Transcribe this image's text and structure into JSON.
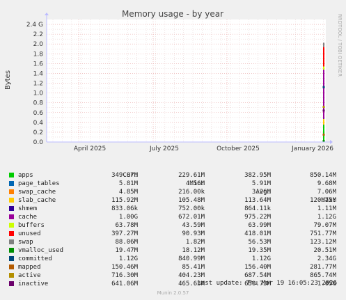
{
  "chart_data": {
    "type": "line",
    "title": "Memory usage - by year",
    "ylabel": "Bytes",
    "side_label": "RRDTOOL / TOBI OETIKER",
    "ylim": [
      0,
      2.5
    ],
    "y_unit": "G",
    "y_ticks": [
      "0.0",
      "0.2",
      "0.4",
      "0.6",
      "0.8",
      "1.0",
      "1.2",
      "1.4",
      "1.6",
      "1.8",
      "2.0",
      "2.2",
      "2.4 G"
    ],
    "x_ticks": [
      "April 2025",
      "July 2025",
      "October 2025",
      "January 2026"
    ],
    "grid": true,
    "last_values_G": {
      "apps": 0.34978,
      "page_tables": 0.00581,
      "swap_cache": 0.00485,
      "slab_cache": 0.11592,
      "shmem": 0.00083,
      "cache": 1.0,
      "buffers": 0.06378,
      "unused": 0.39727,
      "swap": 0.08806,
      "vmalloc_used": 0.01947,
      "committed": 1.12,
      "mapped": 0.15046,
      "active": 0.7163,
      "inactive": 0.64106
    }
  },
  "legend": {
    "headers": {
      "cur": "Cur:",
      "min": "Min:",
      "avg": "Avg:",
      "max": "Max:"
    },
    "rows": [
      {
        "name": "apps",
        "color": "#00cc00",
        "cur": "349.87M",
        "min": "229.61M",
        "avg": "382.95M",
        "max": "850.14M"
      },
      {
        "name": "page_tables",
        "color": "#0066b3",
        "cur": "5.81M",
        "min": "4.56M",
        "avg": "5.91M",
        "max": "9.68M"
      },
      {
        "name": "swap_cache",
        "color": "#ff8000",
        "cur": "4.85M",
        "min": "216.00k",
        "avg": "3.26M",
        "max": "7.06M"
      },
      {
        "name": "slab_cache",
        "color": "#ffcc00",
        "cur": "115.92M",
        "min": "105.48M",
        "avg": "113.64M",
        "max": "120.75M"
      },
      {
        "name": "shmem",
        "color": "#330099",
        "cur": "833.06k",
        "min": "752.00k",
        "avg": "864.11k",
        "max": "1.11M"
      },
      {
        "name": "cache",
        "color": "#990099",
        "cur": "1.00G",
        "min": "672.01M",
        "avg": "975.22M",
        "max": "1.12G"
      },
      {
        "name": "buffers",
        "color": "#ccff00",
        "cur": "63.78M",
        "min": "43.59M",
        "avg": "63.99M",
        "max": "79.07M"
      },
      {
        "name": "unused",
        "color": "#ff0000",
        "cur": "397.27M",
        "min": "90.93M",
        "avg": "418.01M",
        "max": "751.77M"
      },
      {
        "name": "swap",
        "color": "#808080",
        "cur": "88.06M",
        "min": "1.82M",
        "avg": "56.53M",
        "max": "123.12M"
      },
      {
        "name": "vmalloc_used",
        "color": "#008f00",
        "cur": "19.47M",
        "min": "18.12M",
        "avg": "19.35M",
        "max": "20.51M"
      },
      {
        "name": "committed",
        "color": "#00487d",
        "cur": "1.12G",
        "min": "840.99M",
        "avg": "1.12G",
        "max": "2.34G"
      },
      {
        "name": "mapped",
        "color": "#b35a00",
        "cur": "150.46M",
        "min": "85.41M",
        "avg": "156.40M",
        "max": "281.77M"
      },
      {
        "name": "active",
        "color": "#b38f00",
        "cur": "716.30M",
        "min": "404.23M",
        "avg": "687.54M",
        "max": "865.74M"
      },
      {
        "name": "inactive",
        "color": "#6b006b",
        "cur": "641.06M",
        "min": "465.63M",
        "avg": "650.73M",
        "max": "1.05G"
      }
    ]
  },
  "footer": {
    "last_update": "Last update: Thu Mar 19 16:05:23 2026",
    "version": "Munin 2.0.57"
  }
}
